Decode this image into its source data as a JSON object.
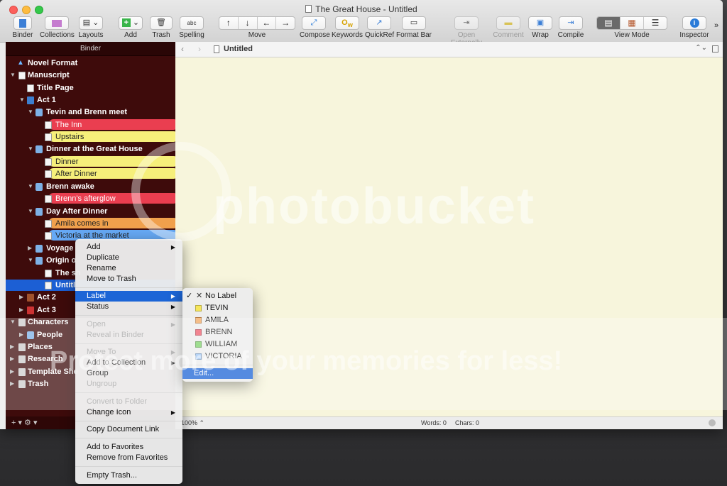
{
  "window": {
    "title": "The Great House - Untitled"
  },
  "toolbar": {
    "binder": "Binder",
    "collections": "Collections",
    "layouts": "Layouts",
    "add": "Add",
    "trash": "Trash",
    "spelling": "Spelling",
    "move": "Move",
    "compose": "Compose",
    "keywords": "Keywords",
    "quickref": "QuickRef",
    "format_bar": "Format Bar",
    "open_externally": "Open Externally",
    "comment": "Comment",
    "wrap": "Wrap",
    "compile": "Compile",
    "view_mode": "View Mode",
    "inspector": "Inspector",
    "spelling_glyph": "abc"
  },
  "binder": {
    "header": "Binder",
    "items": [
      {
        "label": "Novel Format"
      },
      {
        "label": "Manuscript"
      },
      {
        "label": "Title Page"
      },
      {
        "label": "Act 1"
      },
      {
        "label": "Tevin and Brenn meet"
      },
      {
        "label": "The Inn"
      },
      {
        "label": "Upstairs"
      },
      {
        "label": "Dinner at the Great House"
      },
      {
        "label": "Dinner"
      },
      {
        "label": "After Dinner"
      },
      {
        "label": "Brenn awake"
      },
      {
        "label": "Brenn's afterglow"
      },
      {
        "label": "Day After Dinner"
      },
      {
        "label": "Amila comes in"
      },
      {
        "label": "Victoria at the market"
      },
      {
        "label": "Voyage"
      },
      {
        "label": "Origin o"
      },
      {
        "label": "The sh"
      },
      {
        "label": "Untitl"
      },
      {
        "label": "Act 2"
      },
      {
        "label": "Act 3"
      },
      {
        "label": "Characters"
      },
      {
        "label": "People"
      },
      {
        "label": "Places"
      },
      {
        "label": "Research"
      },
      {
        "label": "Template She"
      },
      {
        "label": "Trash"
      }
    ],
    "footer": "+  ▾  ⚙ ▾"
  },
  "editor": {
    "doc_title": "Untitled",
    "zoom": "100%",
    "words": "Words: 0",
    "chars": "Chars: 0"
  },
  "context_menu": {
    "items": [
      {
        "label": "Add"
      },
      {
        "label": "Duplicate"
      },
      {
        "label": "Rename"
      },
      {
        "label": "Move to Trash"
      },
      {
        "label": "Label"
      },
      {
        "label": "Status"
      },
      {
        "label": "Open"
      },
      {
        "label": "Reveal in Binder"
      },
      {
        "label": "Move To"
      },
      {
        "label": "Add to Collection"
      },
      {
        "label": "Group"
      },
      {
        "label": "Ungroup"
      },
      {
        "label": "Convert to Folder"
      },
      {
        "label": "Change Icon"
      },
      {
        "label": "Copy Document Link"
      },
      {
        "label": "Add to Favorites"
      },
      {
        "label": "Remove from Favorites"
      },
      {
        "label": "Empty Trash..."
      }
    ]
  },
  "label_menu": {
    "items": [
      {
        "label": "No Label",
        "color": "",
        "checked": "✓"
      },
      {
        "label": "TEVIN",
        "color": "#f6e65a"
      },
      {
        "label": "AMILA",
        "color": "#f2a860"
      },
      {
        "label": "BRENN",
        "color": "#ee5b6b"
      },
      {
        "label": "WILLIAM",
        "color": "#7fd36b"
      },
      {
        "label": "VICTORIA",
        "color": "#9cc4f5"
      }
    ],
    "edit": "Edit..."
  },
  "watermark": {
    "main": "photobucket",
    "sub": "Protect more of your memories for less!"
  }
}
